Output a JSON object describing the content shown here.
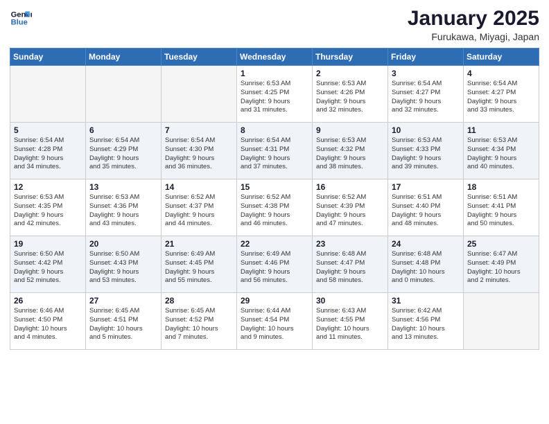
{
  "logo": {
    "line1": "General",
    "line2": "Blue"
  },
  "title": "January 2025",
  "location": "Furukawa, Miyagi, Japan",
  "days_header": [
    "Sunday",
    "Monday",
    "Tuesday",
    "Wednesday",
    "Thursday",
    "Friday",
    "Saturday"
  ],
  "weeks": [
    [
      {
        "num": "",
        "text": ""
      },
      {
        "num": "",
        "text": ""
      },
      {
        "num": "",
        "text": ""
      },
      {
        "num": "1",
        "text": "Sunrise: 6:53 AM\nSunset: 4:25 PM\nDaylight: 9 hours\nand 31 minutes."
      },
      {
        "num": "2",
        "text": "Sunrise: 6:53 AM\nSunset: 4:26 PM\nDaylight: 9 hours\nand 32 minutes."
      },
      {
        "num": "3",
        "text": "Sunrise: 6:54 AM\nSunset: 4:27 PM\nDaylight: 9 hours\nand 32 minutes."
      },
      {
        "num": "4",
        "text": "Sunrise: 6:54 AM\nSunset: 4:27 PM\nDaylight: 9 hours\nand 33 minutes."
      }
    ],
    [
      {
        "num": "5",
        "text": "Sunrise: 6:54 AM\nSunset: 4:28 PM\nDaylight: 9 hours\nand 34 minutes."
      },
      {
        "num": "6",
        "text": "Sunrise: 6:54 AM\nSunset: 4:29 PM\nDaylight: 9 hours\nand 35 minutes."
      },
      {
        "num": "7",
        "text": "Sunrise: 6:54 AM\nSunset: 4:30 PM\nDaylight: 9 hours\nand 36 minutes."
      },
      {
        "num": "8",
        "text": "Sunrise: 6:54 AM\nSunset: 4:31 PM\nDaylight: 9 hours\nand 37 minutes."
      },
      {
        "num": "9",
        "text": "Sunrise: 6:53 AM\nSunset: 4:32 PM\nDaylight: 9 hours\nand 38 minutes."
      },
      {
        "num": "10",
        "text": "Sunrise: 6:53 AM\nSunset: 4:33 PM\nDaylight: 9 hours\nand 39 minutes."
      },
      {
        "num": "11",
        "text": "Sunrise: 6:53 AM\nSunset: 4:34 PM\nDaylight: 9 hours\nand 40 minutes."
      }
    ],
    [
      {
        "num": "12",
        "text": "Sunrise: 6:53 AM\nSunset: 4:35 PM\nDaylight: 9 hours\nand 42 minutes."
      },
      {
        "num": "13",
        "text": "Sunrise: 6:53 AM\nSunset: 4:36 PM\nDaylight: 9 hours\nand 43 minutes."
      },
      {
        "num": "14",
        "text": "Sunrise: 6:52 AM\nSunset: 4:37 PM\nDaylight: 9 hours\nand 44 minutes."
      },
      {
        "num": "15",
        "text": "Sunrise: 6:52 AM\nSunset: 4:38 PM\nDaylight: 9 hours\nand 46 minutes."
      },
      {
        "num": "16",
        "text": "Sunrise: 6:52 AM\nSunset: 4:39 PM\nDaylight: 9 hours\nand 47 minutes."
      },
      {
        "num": "17",
        "text": "Sunrise: 6:51 AM\nSunset: 4:40 PM\nDaylight: 9 hours\nand 48 minutes."
      },
      {
        "num": "18",
        "text": "Sunrise: 6:51 AM\nSunset: 4:41 PM\nDaylight: 9 hours\nand 50 minutes."
      }
    ],
    [
      {
        "num": "19",
        "text": "Sunrise: 6:50 AM\nSunset: 4:42 PM\nDaylight: 9 hours\nand 52 minutes."
      },
      {
        "num": "20",
        "text": "Sunrise: 6:50 AM\nSunset: 4:43 PM\nDaylight: 9 hours\nand 53 minutes."
      },
      {
        "num": "21",
        "text": "Sunrise: 6:49 AM\nSunset: 4:45 PM\nDaylight: 9 hours\nand 55 minutes."
      },
      {
        "num": "22",
        "text": "Sunrise: 6:49 AM\nSunset: 4:46 PM\nDaylight: 9 hours\nand 56 minutes."
      },
      {
        "num": "23",
        "text": "Sunrise: 6:48 AM\nSunset: 4:47 PM\nDaylight: 9 hours\nand 58 minutes."
      },
      {
        "num": "24",
        "text": "Sunrise: 6:48 AM\nSunset: 4:48 PM\nDaylight: 10 hours\nand 0 minutes."
      },
      {
        "num": "25",
        "text": "Sunrise: 6:47 AM\nSunset: 4:49 PM\nDaylight: 10 hours\nand 2 minutes."
      }
    ],
    [
      {
        "num": "26",
        "text": "Sunrise: 6:46 AM\nSunset: 4:50 PM\nDaylight: 10 hours\nand 4 minutes."
      },
      {
        "num": "27",
        "text": "Sunrise: 6:45 AM\nSunset: 4:51 PM\nDaylight: 10 hours\nand 5 minutes."
      },
      {
        "num": "28",
        "text": "Sunrise: 6:45 AM\nSunset: 4:52 PM\nDaylight: 10 hours\nand 7 minutes."
      },
      {
        "num": "29",
        "text": "Sunrise: 6:44 AM\nSunset: 4:54 PM\nDaylight: 10 hours\nand 9 minutes."
      },
      {
        "num": "30",
        "text": "Sunrise: 6:43 AM\nSunset: 4:55 PM\nDaylight: 10 hours\nand 11 minutes."
      },
      {
        "num": "31",
        "text": "Sunrise: 6:42 AM\nSunset: 4:56 PM\nDaylight: 10 hours\nand 13 minutes."
      },
      {
        "num": "",
        "text": ""
      }
    ]
  ]
}
